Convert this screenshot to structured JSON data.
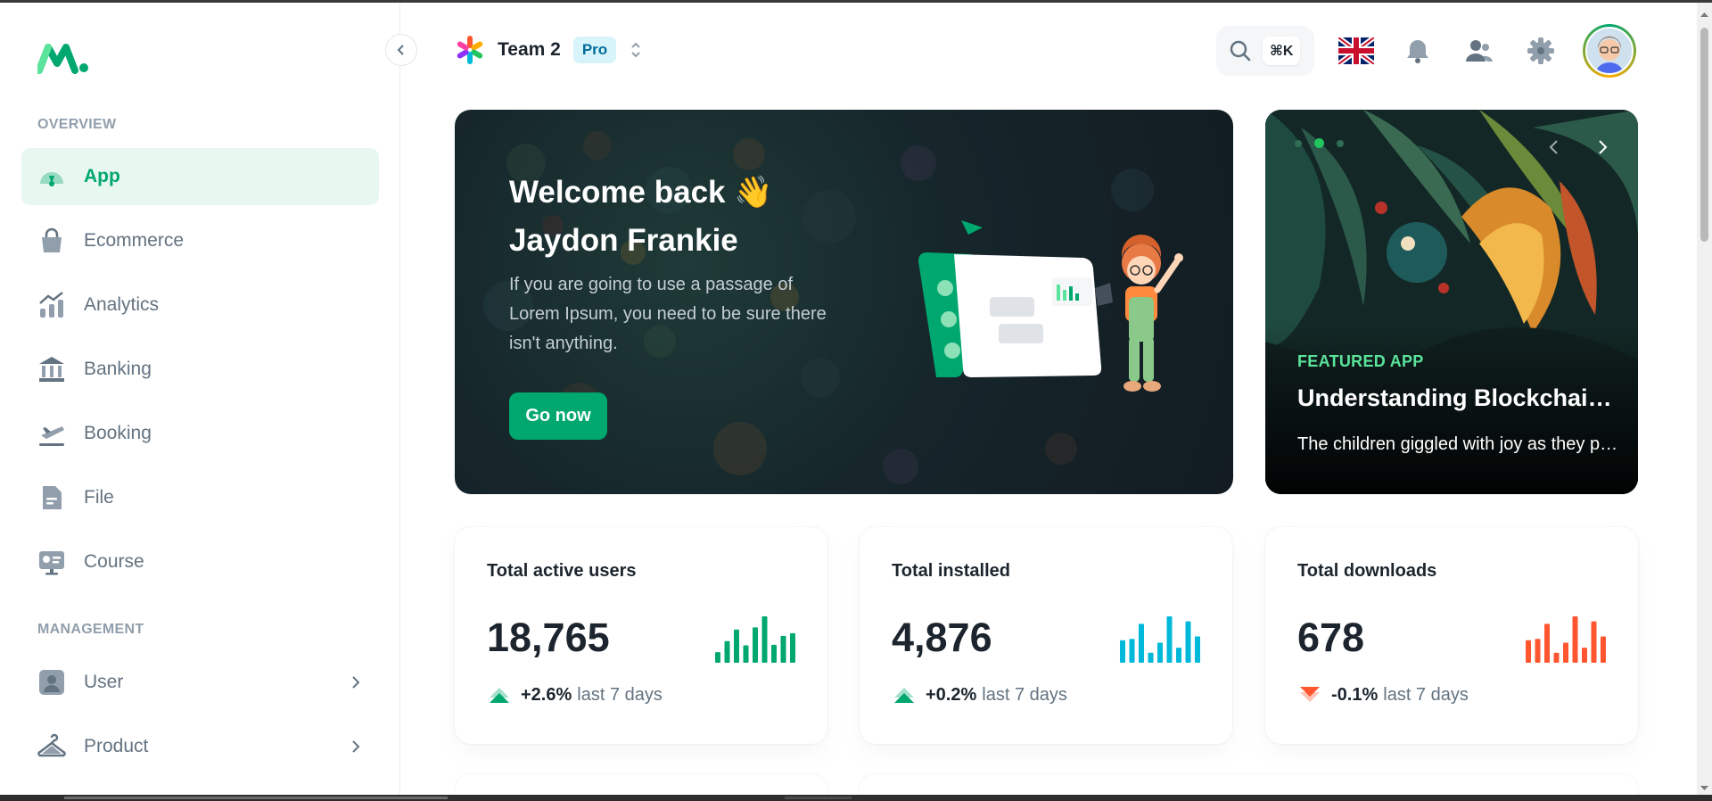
{
  "sidebar": {
    "sections": [
      {
        "label": "OVERVIEW"
      },
      {
        "label": "MANAGEMENT"
      }
    ],
    "items": [
      {
        "label": "App",
        "icon": "speedometer-icon",
        "active": true
      },
      {
        "label": "Ecommerce",
        "icon": "shopping-bag-icon"
      },
      {
        "label": "Analytics",
        "icon": "analytics-chart-icon"
      },
      {
        "label": "Banking",
        "icon": "bank-icon"
      },
      {
        "label": "Booking",
        "icon": "airplane-icon"
      },
      {
        "label": "File",
        "icon": "file-icon"
      },
      {
        "label": "Course",
        "icon": "course-screen-icon"
      },
      {
        "label": "User",
        "icon": "user-icon",
        "has_children": true
      },
      {
        "label": "Product",
        "icon": "product-hanger-icon",
        "has_children": true
      }
    ]
  },
  "header": {
    "team_name": "Team 2",
    "plan_badge": "Pro",
    "search_shortcut": "⌘K"
  },
  "welcome": {
    "title_line1": "Welcome back 👋",
    "title_line2": "Jaydon Frankie",
    "description": "If you are going to use a passage of Lorem Ipsum, you need to be sure there isn't anything.",
    "button_label": "Go now"
  },
  "featured": {
    "label": "FEATURED APP",
    "title": "Understanding Blockchain Technology: Beyond Cryptocurrency",
    "description": "The children giggled with joy as they played in the park."
  },
  "stats": [
    {
      "title": "Total active users",
      "value": "18,765",
      "change": "+2.6%",
      "period": "last 7 days",
      "trend": "up",
      "color": "#00a76f",
      "bars": [
        20,
        41,
        63,
        33,
        67,
        88,
        34,
        51,
        56
      ]
    },
    {
      "title": "Total installed",
      "value": "4,876",
      "change": "+0.2%",
      "period": "last 7 days",
      "trend": "up",
      "color": "#00b8d9",
      "bars": [
        18,
        19,
        31,
        8,
        16,
        37,
        12,
        33,
        21
      ]
    },
    {
      "title": "Total downloads",
      "value": "678",
      "change": "-0.1%",
      "period": "last 7 days",
      "trend": "down",
      "color": "#ff5630",
      "bars": [
        18,
        19,
        31,
        8,
        16,
        37,
        12,
        33,
        21
      ]
    }
  ],
  "colors": {
    "primary": "#00a76f",
    "info": "#00b8d9",
    "error": "#ff5630",
    "active_bg": "#e8f7ef"
  }
}
